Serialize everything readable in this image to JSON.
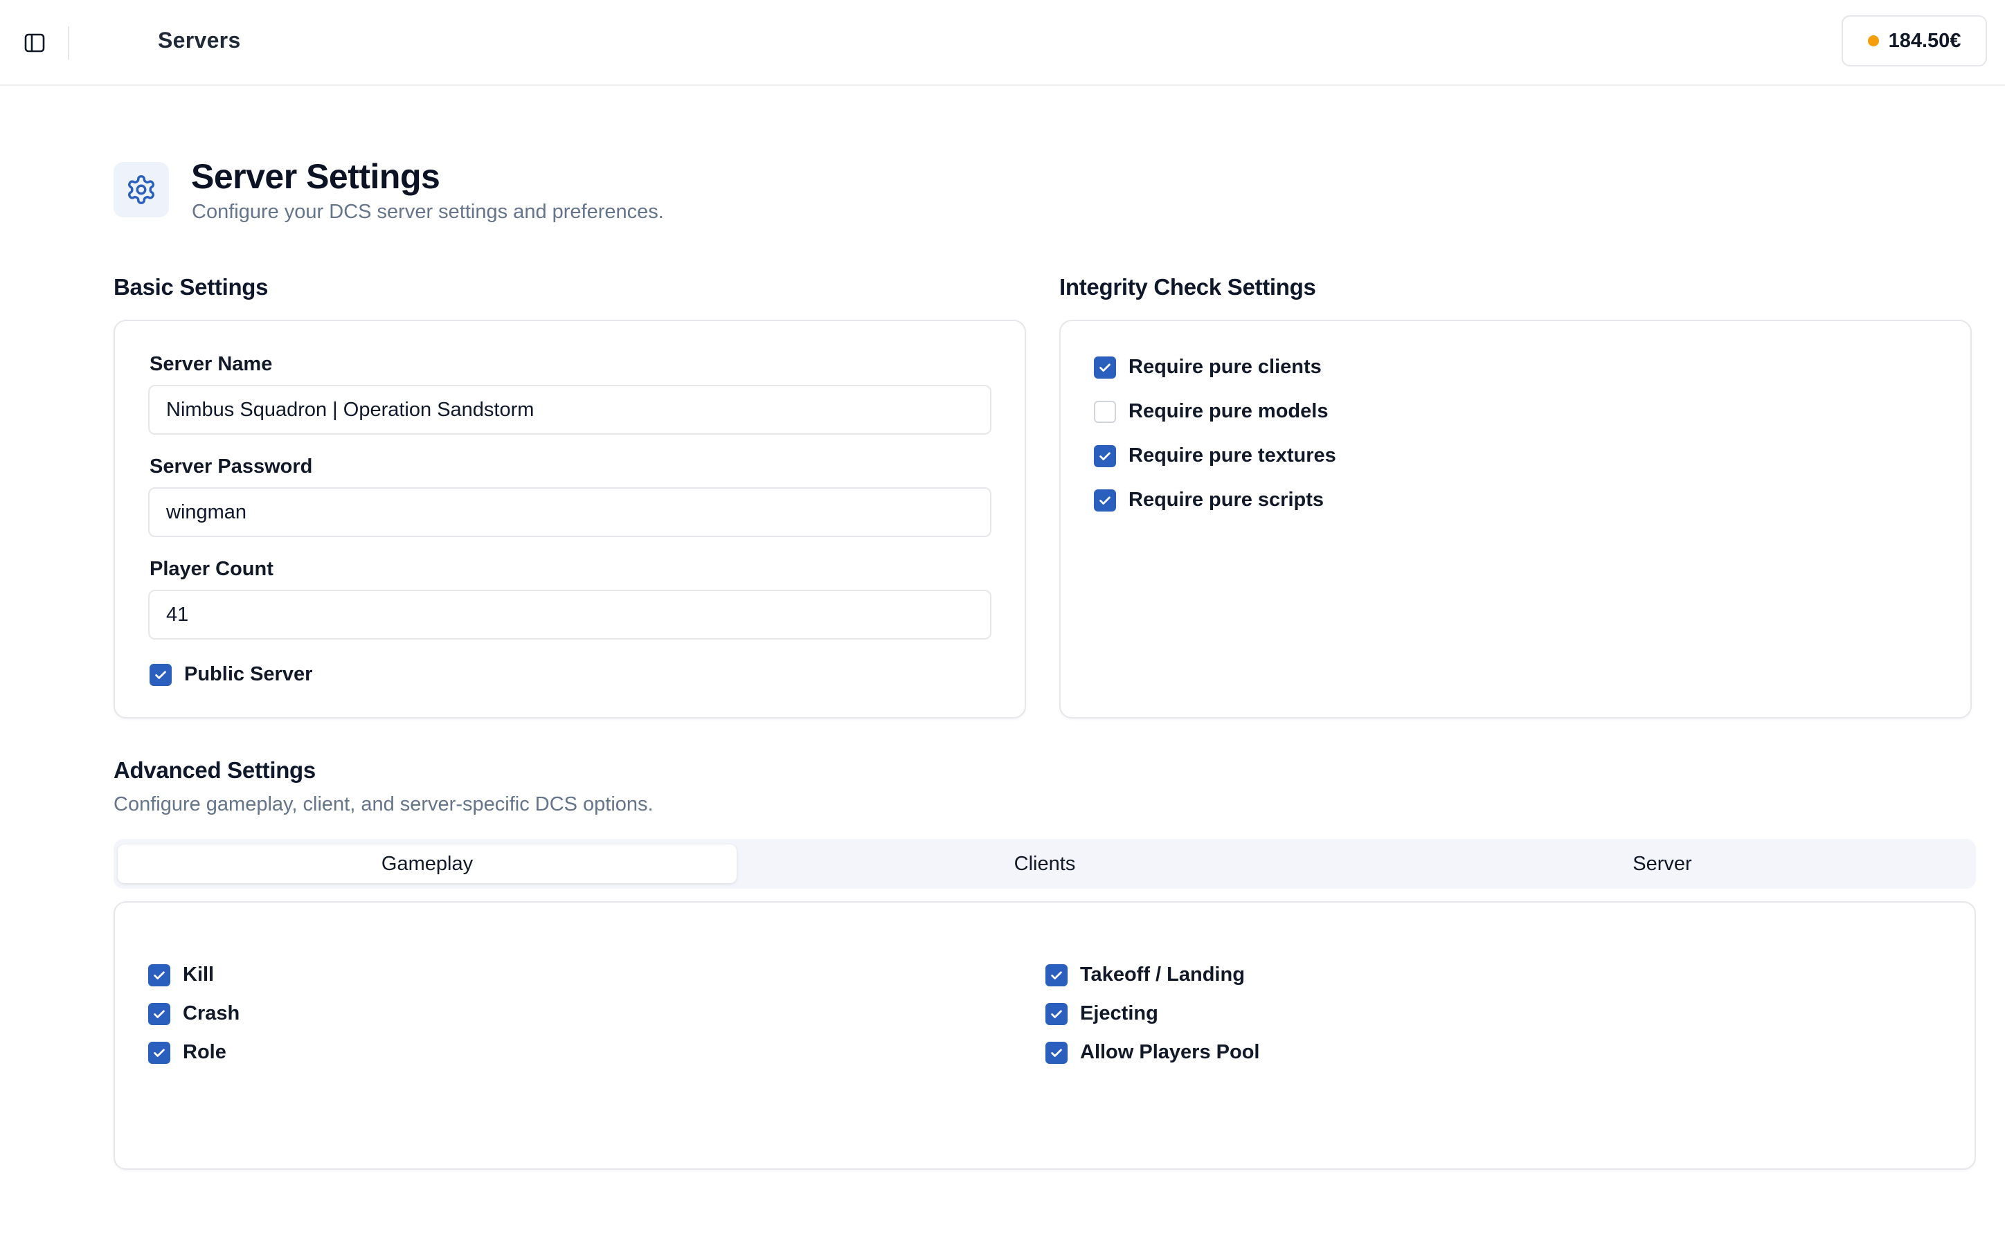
{
  "topbar": {
    "title": "Servers",
    "balance": "184.50€",
    "sidebar_toggle_icon": "sidebar-icon",
    "balance_dot_color": "#f59e0b"
  },
  "page": {
    "icon": "gear-icon",
    "title": "Server Settings",
    "subtitle": "Configure your DCS server settings and preferences."
  },
  "basic": {
    "title": "Basic Settings",
    "server_name_label": "Server Name",
    "server_name_value": "Nimbus Squadron | Operation Sandstorm",
    "server_password_label": "Server Password",
    "server_password_value": "wingman",
    "player_count_label": "Player Count",
    "player_count_value": "41",
    "public_server_label": "Public Server",
    "public_server_checked": true
  },
  "integrity": {
    "title": "Integrity Check Settings",
    "items": [
      {
        "label": "Require pure clients",
        "checked": true
      },
      {
        "label": "Require pure models",
        "checked": false
      },
      {
        "label": "Require pure textures",
        "checked": true
      },
      {
        "label": "Require pure scripts",
        "checked": true
      }
    ]
  },
  "advanced": {
    "title": "Advanced Settings",
    "subtitle": "Configure gameplay, client, and server-specific DCS options.",
    "tabs": [
      {
        "label": "Gameplay",
        "active": true
      },
      {
        "label": "Clients",
        "active": false
      },
      {
        "label": "Server",
        "active": false
      }
    ],
    "gameplay_left": [
      {
        "label": "Kill",
        "checked": true
      },
      {
        "label": "Crash",
        "checked": true
      },
      {
        "label": "Role",
        "checked": true
      }
    ],
    "gameplay_right": [
      {
        "label": "Takeoff / Landing",
        "checked": true
      },
      {
        "label": "Ejecting",
        "checked": true
      },
      {
        "label": "Allow Players Pool",
        "checked": true
      }
    ]
  },
  "colors": {
    "accent": "#2b5fbe",
    "muted_text": "#64748b",
    "border": "#e5e7eb"
  }
}
